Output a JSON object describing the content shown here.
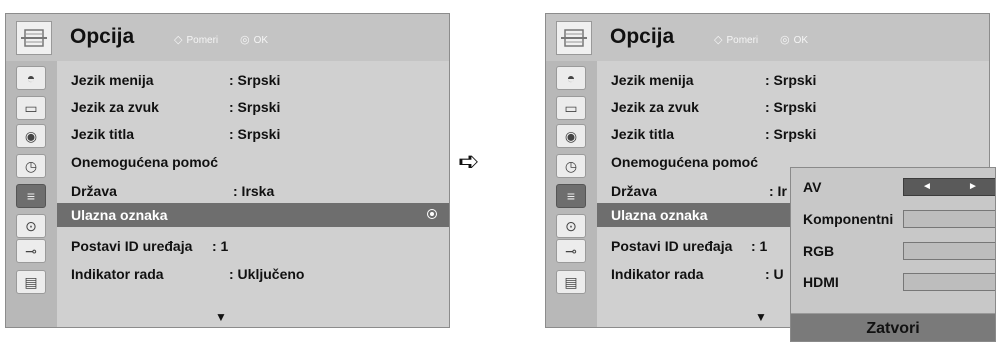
{
  "left": {
    "title": "Opcija",
    "hint_move": "Pomeri",
    "hint_ok": "OK",
    "items": [
      {
        "label": "Jezik menija",
        "value": ": Srpski"
      },
      {
        "label": "Jezik za zvuk",
        "value": ": Srpski"
      },
      {
        "label": "Jezik titla",
        "value": ": Srpski"
      },
      {
        "label": "Onemogućena pomoć",
        "value": ""
      },
      {
        "label": "Država",
        "value": ": Irska"
      },
      {
        "label": "Ulazna oznaka",
        "value": ""
      },
      {
        "label": "Postavi ID uređaja",
        "value": ": 1"
      },
      {
        "label": "Indikator rada",
        "value": ": Uključeno"
      }
    ]
  },
  "right": {
    "title": "Opcija",
    "hint_move": "Pomeri",
    "hint_ok": "OK",
    "items": [
      {
        "label": "Jezik menija",
        "value": ": Srpski"
      },
      {
        "label": "Jezik za zvuk",
        "value": ": Srpski"
      },
      {
        "label": "Jezik titla",
        "value": ": Srpski"
      },
      {
        "label": "Onemogućena pomoć",
        "value": ""
      },
      {
        "label": "Država",
        "value": ": Ir"
      },
      {
        "label": "Ulazna oznaka",
        "value": ""
      },
      {
        "label": "Postavi ID uređaja",
        "value": ": 1"
      },
      {
        "label": "Indikator rada",
        "value": ": U"
      }
    ]
  },
  "popup": {
    "rows": [
      "AV",
      "Komponentni",
      "RGB",
      "HDMI"
    ],
    "close": "Zatvori"
  },
  "glyphs": {
    "down_arrow": "▼",
    "step_arrow": "➪",
    "left": "◄",
    "right": "►",
    "move": "◇",
    "ok": "◎"
  }
}
